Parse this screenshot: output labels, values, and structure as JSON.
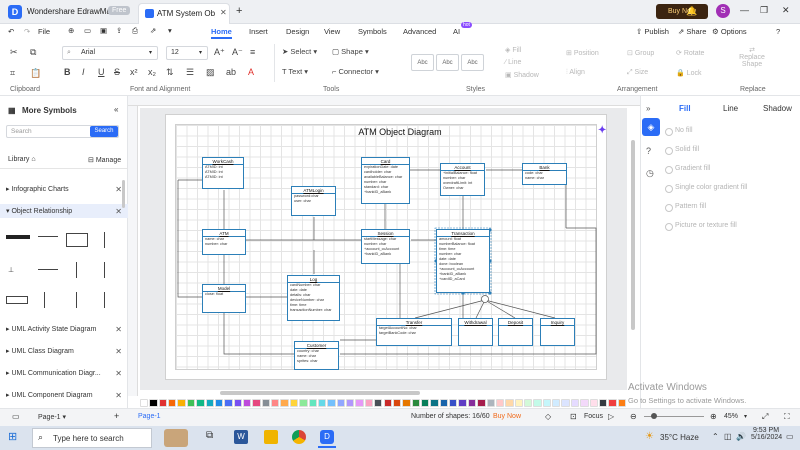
{
  "titlebar": {
    "app_name": "Wondershare EdrawMax",
    "badge": "Free",
    "tab_title": "ATM System Obje...",
    "buy_now": "Buy Now",
    "avatar_initial": "S"
  },
  "menu": {
    "file": "File",
    "items": [
      "Home",
      "Insert",
      "Design",
      "View",
      "Symbols",
      "Advanced",
      "AI"
    ],
    "active": "Home",
    "ai_badge": "hot",
    "right": [
      "Publish",
      "Share",
      "Options"
    ]
  },
  "ribbon": {
    "font": "Arial",
    "size": "12",
    "select": "Select",
    "shape": "Shape",
    "text": "Text",
    "connector": "Connector",
    "style_sample": "Abc",
    "fill": "Fill",
    "line": "Line",
    "shadow": "Shadow",
    "position": "Position",
    "group": "Group",
    "rotate": "Rotate",
    "align": "Align",
    "size_btn": "Size",
    "lock": "Lock",
    "replace_shape": "Replace Shape",
    "groups": [
      "Clipboard",
      "Font and Alignment",
      "Tools",
      "Styles",
      "Arrangement",
      "Replace"
    ]
  },
  "left_panel": {
    "title": "More Symbols",
    "search_placeholder": "Search",
    "search_btn": "Search",
    "library": "Library",
    "manage": "Manage",
    "libraries": [
      "Infographic Charts",
      "Object Relationship",
      "UML Activity State Diagram",
      "UML Class Diagram",
      "UML Communication Diagr...",
      "UML Component Diagram"
    ]
  },
  "diagram": {
    "title": "ATM Object Diagram",
    "classes": [
      {
        "name": "WorkCash",
        "attrs": [
          "ATMID: int",
          "ATMID: int",
          "ATMID: int"
        ]
      },
      {
        "name": "Card",
        "attrs": [
          "expirationDate: date",
          "cardholder: char",
          "availableBalance: char",
          "number: char",
          "standard: char",
          "+bankID_aBank"
        ]
      },
      {
        "name": "Account",
        "attrs": [
          "+initialBalance: float",
          "number: char",
          "overdraftLimit: int",
          "Owner: char"
        ]
      },
      {
        "name": "Bank",
        "attrs": [
          "code: char",
          "name: char"
        ]
      },
      {
        "name": "ATMLogin",
        "attrs": [
          "password:char",
          "user: char"
        ]
      },
      {
        "name": "ATM",
        "attrs": [
          "name: char",
          "number: char"
        ]
      },
      {
        "name": "Session",
        "attrs": [
          "startMessage: char",
          "number: char",
          "+account_ccAccount",
          "+bankID_aBank"
        ]
      },
      {
        "name": "Transaction",
        "attrs": [
          "amount: float",
          "numberBalance: float",
          "time: time",
          "number: char",
          "date: date",
          "done: boolean",
          "+account_ccAccount",
          "+bankID_aBank",
          "+cardID_aCard"
        ]
      },
      {
        "name": "Model",
        "attrs": [
          "close: float"
        ]
      },
      {
        "name": "Log",
        "attrs": [
          "cardNumber: char",
          "date: date",
          "details: char",
          "deviceNumber: char",
          "time: time",
          "transactionNumber: char"
        ]
      },
      {
        "name": "Transfer",
        "attrs": [
          "targetAccountNo: char",
          "targetBankCode: char"
        ]
      },
      {
        "name": "Withdrawal",
        "attrs": []
      },
      {
        "name": "Deposit",
        "attrs": []
      },
      {
        "name": "Inquiry",
        "attrs": []
      },
      {
        "name": "Customer",
        "attrs": [
          "country: char",
          "name: char",
          "sprites: char"
        ]
      }
    ]
  },
  "right_panel": {
    "tabs": [
      "Fill",
      "Line",
      "Shadow"
    ],
    "options": [
      "No fill",
      "Solid fill",
      "Gradient fill",
      "Single color gradient fill",
      "Pattern fill",
      "Picture or texture fill"
    ]
  },
  "status": {
    "page_tab": "Page-1",
    "page_tab2": "Page-1",
    "shapes": "Number of shapes: 16/60",
    "buy_now": "Buy Now",
    "focus": "Focus",
    "zoom": "45%"
  },
  "watermark": {
    "line1": "Activate Windows",
    "line2": "Go to Settings to activate Windows."
  },
  "taskbar": {
    "search": "Type here to search",
    "weather": "35°C  Haze",
    "time": "9:53 PM",
    "date": "5/16/2024"
  },
  "colors": {
    "accent": "#2b6cf6",
    "uml_border": "#2c7fb8"
  }
}
